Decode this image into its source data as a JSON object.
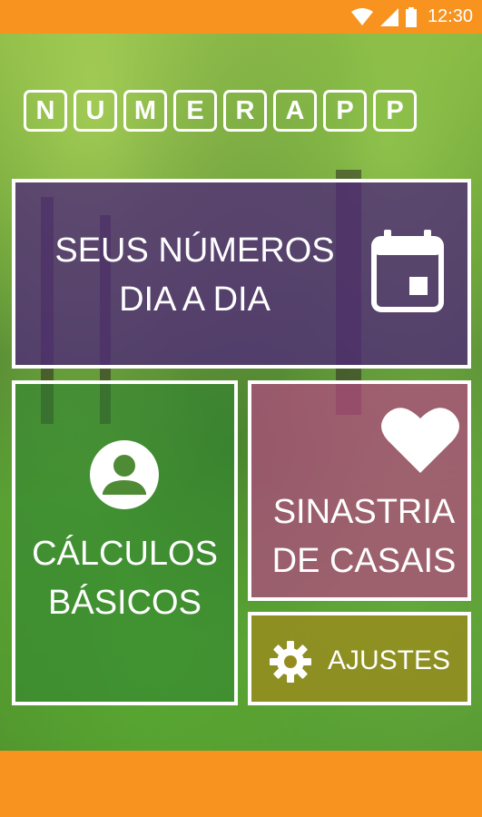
{
  "status_bar": {
    "time": "12:30",
    "icons": [
      "wifi-icon",
      "signal-icon",
      "battery-icon"
    ]
  },
  "logo": {
    "letters": [
      "N",
      "U",
      "M",
      "E",
      "R",
      "A",
      "P",
      "P"
    ]
  },
  "tiles": {
    "dia_a_dia": {
      "line1": "SEUS NÚMEROS",
      "line2": "DIA A DIA",
      "icon": "calendar-icon"
    },
    "calculos": {
      "line1": "CÁLCULOS",
      "line2": "BÁSICOS",
      "icon": "person-icon"
    },
    "sinastria": {
      "line1": "SINASTRIA",
      "line2": "DE CASAIS",
      "icon": "heart-icon"
    },
    "ajustes": {
      "label": "AJUSTES",
      "icon": "gear-icon"
    }
  },
  "colors": {
    "status_bar": "#f7931e",
    "tile_dia": "#502878",
    "tile_calc": "#2d8232",
    "tile_sinastria": "#b44682",
    "tile_ajustes": "#968c1e"
  }
}
